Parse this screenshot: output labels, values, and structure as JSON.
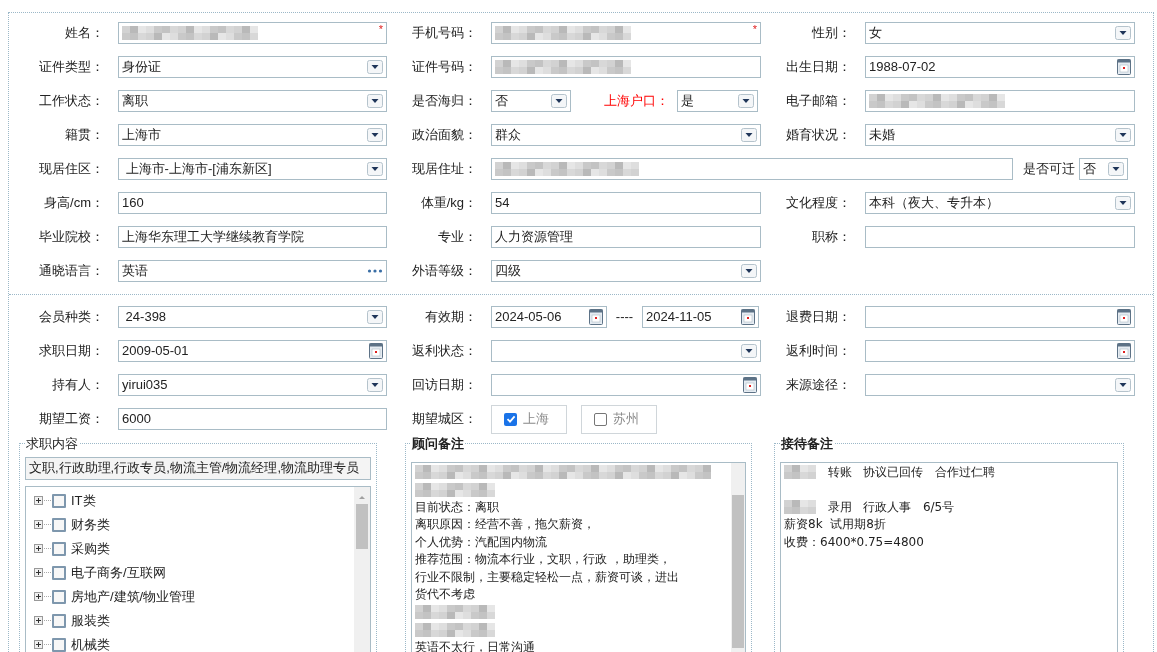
{
  "personal": {
    "rows": [
      [
        {
          "label": "姓名：",
          "kind": "text",
          "required_mark": "*",
          "redacted": true
        },
        {
          "label": "手机号码：",
          "kind": "text",
          "required_mark": "*",
          "redacted": true
        },
        {
          "label": "性别：",
          "kind": "select",
          "value": "女"
        }
      ],
      [
        {
          "label": "证件类型：",
          "kind": "select",
          "value": "身份证"
        },
        {
          "label": "证件号码：",
          "kind": "text",
          "redacted": true
        },
        {
          "label": "出生日期：",
          "kind": "date",
          "value": "1988-07-02"
        }
      ],
      [
        {
          "label": "工作状态：",
          "kind": "select",
          "value": "离职"
        },
        {
          "label": "是否海归：",
          "kind": "split",
          "items": [
            {
              "value": "否"
            },
            {
              "label": "上海户口：",
              "emphasis": true,
              "value": "是"
            }
          ]
        },
        {
          "label": "电子邮箱：",
          "kind": "text",
          "redacted": true
        }
      ],
      [
        {
          "label": "籍贯：",
          "kind": "select",
          "value": "上海市"
        },
        {
          "label": "政治面貌：",
          "kind": "select",
          "value": "群众"
        },
        {
          "label": "婚育状况：",
          "kind": "select",
          "value": "未婚"
        }
      ],
      [
        {
          "label": "现居住区：",
          "kind": "select",
          "value": " 上海市-上海市-[浦东新区]"
        },
        {
          "label": "现居住址：",
          "kind": "address",
          "redacted": true
        },
        {
          "label": "是否可迁",
          "kind": "mini_select",
          "value": "否"
        }
      ],
      [
        {
          "label": "身高/cm：",
          "kind": "text",
          "value": "160"
        },
        {
          "label": "体重/kg：",
          "kind": "text",
          "value": "54"
        },
        {
          "label": "文化程度：",
          "kind": "select",
          "value": "本科（夜大、专升本）"
        }
      ],
      [
        {
          "label": "毕业院校：",
          "kind": "text",
          "value": "上海华东理工大学继续教育学院"
        },
        {
          "label": "专业：",
          "kind": "text",
          "value": "人力资源管理"
        },
        {
          "label": "职称：",
          "kind": "text"
        }
      ],
      [
        {
          "label": "通晓语言：",
          "kind": "picker",
          "value": "英语"
        },
        {
          "label": "外语等级：",
          "kind": "select",
          "value": "四级"
        }
      ]
    ]
  },
  "membership": {
    "rows": [
      [
        {
          "label": "会员种类：",
          "kind": "select",
          "value": " 24-398"
        },
        {
          "label": "有效期：",
          "kind": "date_range",
          "values": [
            "2024-05-06",
            "2024-11-05"
          ],
          "separator": "----"
        },
        {
          "label": "退费日期：",
          "kind": "date"
        }
      ],
      [
        {
          "label": "求职日期：",
          "kind": "date",
          "value": "2009-05-01"
        },
        {
          "label": "返利状态：",
          "kind": "select"
        },
        {
          "label": "返利时间：",
          "kind": "date"
        }
      ],
      [
        {
          "label": "持有人：",
          "kind": "select",
          "value": "yirui035"
        },
        {
          "label": "回访日期：",
          "kind": "date"
        },
        {
          "label": "来源途径：",
          "kind": "select"
        }
      ],
      [
        {
          "label": "期望工资：",
          "kind": "text",
          "value": "6000"
        },
        {
          "label": "期望城区：",
          "kind": "checks",
          "options": [
            {
              "label": "上海",
              "checked": true
            },
            {
              "label": "苏州",
              "checked": false
            }
          ]
        }
      ]
    ]
  },
  "job_content": {
    "title": "求职内容",
    "value": "文职,行政助理,行政专员,物流主管/物流经理,物流助理专员",
    "tree": [
      {
        "label": "IT类",
        "expanded": false,
        "checked": false
      },
      {
        "label": "财务类",
        "expanded": false,
        "checked": false
      },
      {
        "label": "采购类",
        "expanded": false,
        "checked": false
      },
      {
        "label": "电子商务/互联网",
        "expanded": false,
        "checked": false
      },
      {
        "label": "房地产/建筑/物业管理",
        "expanded": false,
        "checked": false
      },
      {
        "label": "服装类",
        "expanded": false,
        "checked": false
      },
      {
        "label": "机械类",
        "expanded": false,
        "checked": false
      }
    ]
  },
  "advisor_notes": {
    "title": "顾问备注",
    "lines": [
      {
        "kind": "redacted"
      },
      {
        "kind": "redacted"
      },
      {
        "kind": "text",
        "text": "目前状态：离职"
      },
      {
        "kind": "text",
        "text": "离职原因：经营不善，拖欠薪资，"
      },
      {
        "kind": "text",
        "text": "个人优势：汽配国内物流"
      },
      {
        "kind": "text",
        "text": "推荐范围：物流本行业，文职，行政 ，助理类，"
      },
      {
        "kind": "text",
        "text": "行业不限制，主要稳定轻松一点，薪资可谈，进出"
      },
      {
        "kind": "text",
        "text": "货代不考虑"
      },
      {
        "kind": "redacted"
      },
      {
        "kind": "redacted"
      },
      {
        "kind": "text",
        "text": "英语不太行，日常沟通"
      }
    ]
  },
  "reception_notes": {
    "title": "接待备注",
    "lines": [
      {
        "kind": "text",
        "prefix_redacted": true,
        "text": "转账   协议已回传   合作过仁聘"
      },
      {
        "kind": "blank"
      },
      {
        "kind": "text",
        "prefix_redacted": true,
        "text": "录用   行政人事   6/5号"
      },
      {
        "kind": "text",
        "text": "薪资8k  试用期8折"
      },
      {
        "kind": "text",
        "text": "收费：6400*0.75=4800"
      }
    ]
  }
}
